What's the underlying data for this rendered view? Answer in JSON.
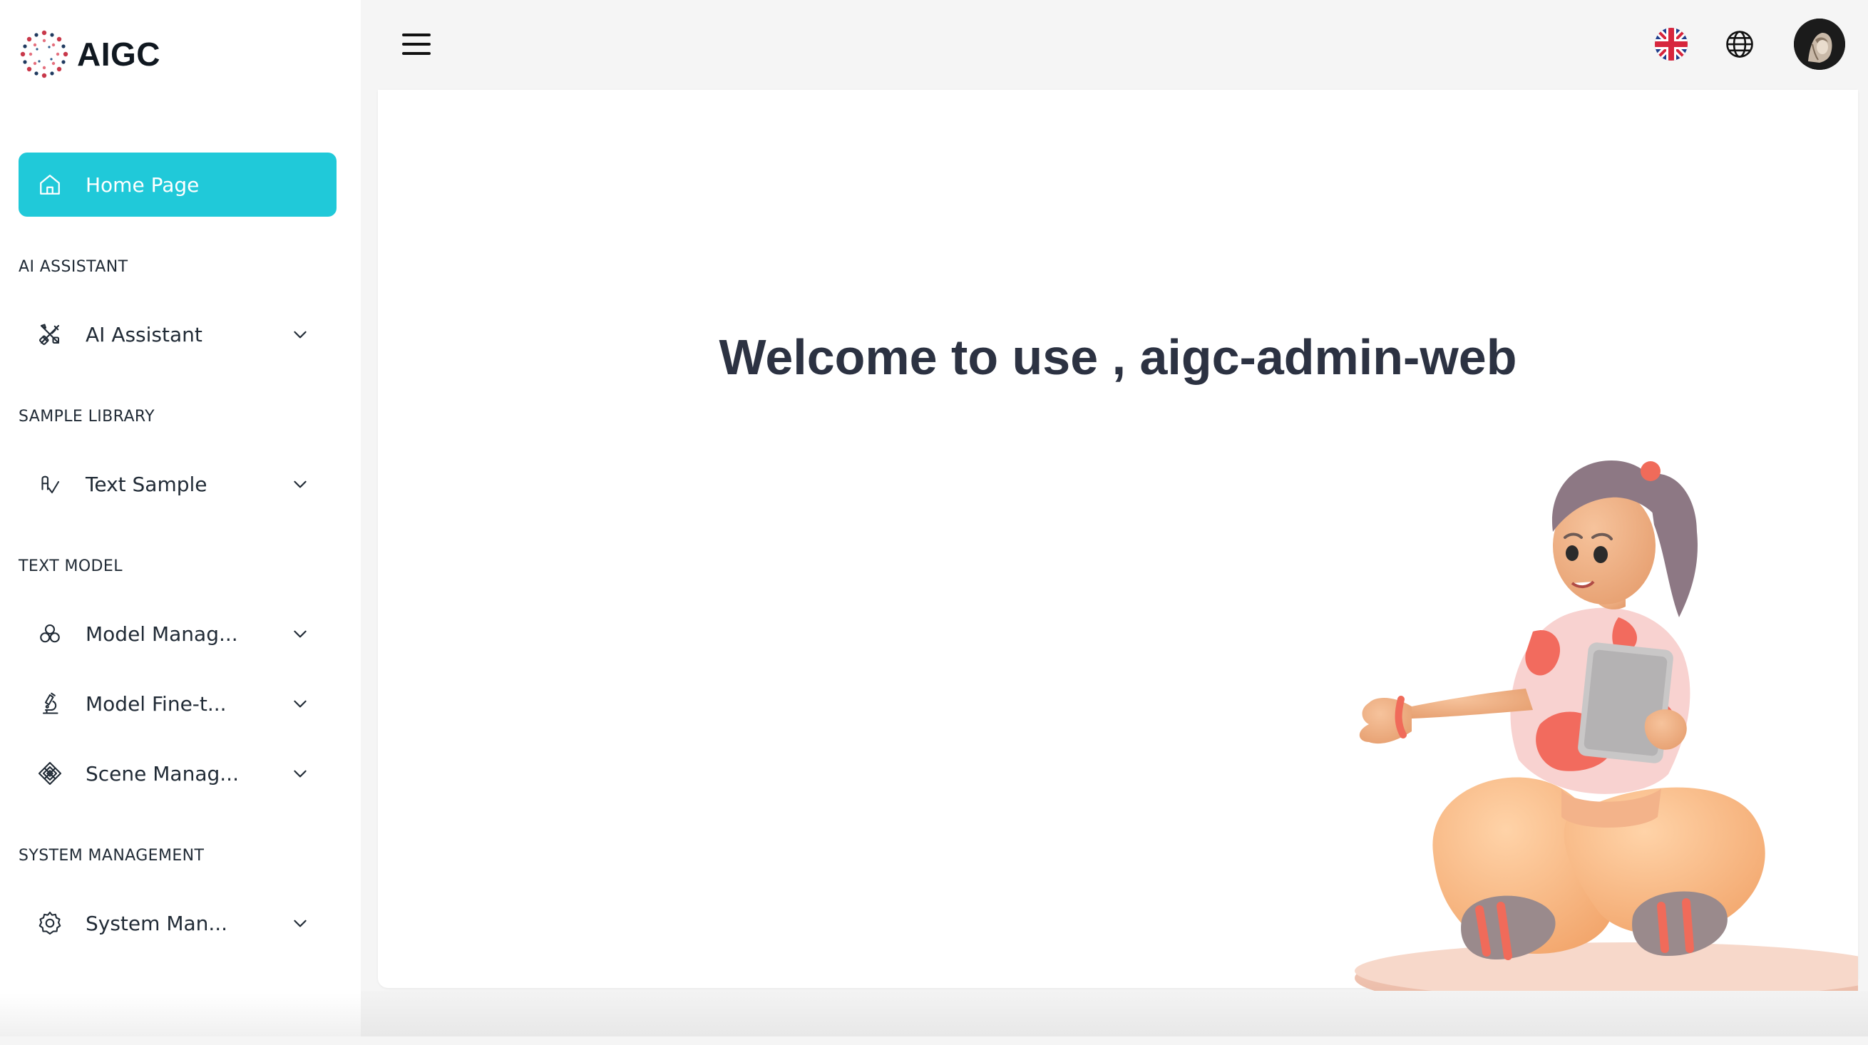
{
  "app": {
    "name": "AIGC"
  },
  "colors": {
    "accent": "#20c9d9",
    "sidebar_bg": "#ffffff",
    "page_bg": "#f5f5f5",
    "text_primary": "#212b36",
    "heading": "#2c3242"
  },
  "sidebar": {
    "home": {
      "label": "Home Page",
      "icon": "home-icon",
      "active": true
    },
    "sections": [
      {
        "header": "AI ASSISTANT",
        "items": [
          {
            "label": "AI Assistant",
            "icon": "tools-icon"
          }
        ]
      },
      {
        "header": "SAMPLE LIBRARY",
        "items": [
          {
            "label": "Text Sample",
            "icon": "text-sample-icon"
          }
        ]
      },
      {
        "header": "TEXT MODEL",
        "items": [
          {
            "label": "Model Manag...",
            "icon": "model-cluster-icon"
          },
          {
            "label": "Model Fine-t...",
            "icon": "microscope-icon"
          },
          {
            "label": "Scene Manag...",
            "icon": "scene-diamond-icon"
          }
        ]
      },
      {
        "header": "SYSTEM MANAGEMENT",
        "items": [
          {
            "label": "System Man...",
            "icon": "gear-icon"
          }
        ]
      }
    ]
  },
  "header": {
    "menu_icon": "hamburger-menu-icon",
    "language_flag_icon": "uk-flag-icon",
    "globe_icon": "globe-icon",
    "avatar_icon": "user-avatar"
  },
  "main": {
    "welcome_text": "Welcome to use , aigc-admin-web",
    "illustration": "girl-sitting-with-tablet-illustration"
  }
}
